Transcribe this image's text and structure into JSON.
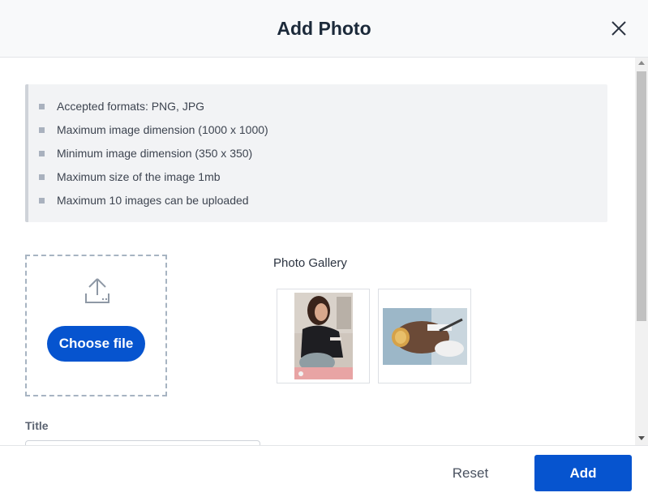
{
  "header": {
    "title": "Add Photo",
    "close_icon": "close-icon"
  },
  "guidelines": {
    "items": [
      {
        "text": "Accepted formats: PNG, JPG"
      },
      {
        "text": "Maximum image dimension (1000 x 1000)"
      },
      {
        "text": "Minimum image dimension (350 x 350)"
      },
      {
        "text": "Maximum size of the image 1mb"
      },
      {
        "text": "Maximum 10 images can be uploaded"
      }
    ]
  },
  "upload": {
    "icon": "upload-icon",
    "choose_label": "Choose file"
  },
  "gallery": {
    "title": "Photo Gallery",
    "photos": [
      {
        "name": "gallery-photo-1",
        "icon": "photo-thumbnail"
      },
      {
        "name": "gallery-photo-2",
        "icon": "photo-thumbnail"
      }
    ]
  },
  "form": {
    "title_label": "Title",
    "title_value": ""
  },
  "footer": {
    "reset_label": "Reset",
    "add_label": "Add"
  },
  "colors": {
    "primary": "#0654cf",
    "header_bg": "#f8f9fa",
    "info_bg": "#f2f3f5"
  }
}
